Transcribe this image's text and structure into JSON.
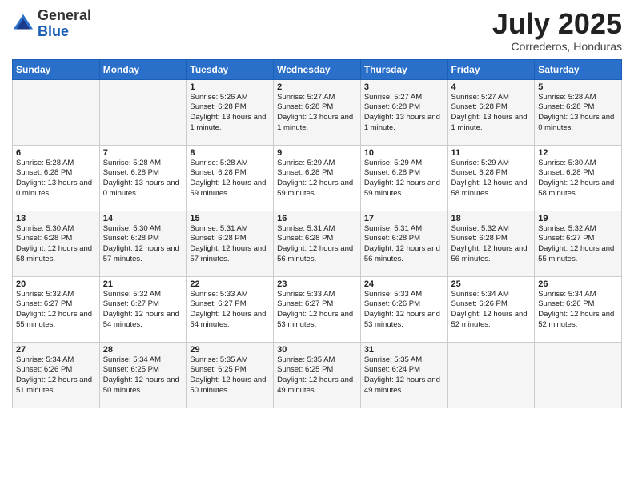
{
  "header": {
    "logo_general": "General",
    "logo_blue": "Blue",
    "month": "July 2025",
    "location": "Correderos, Honduras"
  },
  "weekdays": [
    "Sunday",
    "Monday",
    "Tuesday",
    "Wednesday",
    "Thursday",
    "Friday",
    "Saturday"
  ],
  "weeks": [
    [
      {
        "day": "",
        "info": ""
      },
      {
        "day": "",
        "info": ""
      },
      {
        "day": "1",
        "info": "Sunrise: 5:26 AM\nSunset: 6:28 PM\nDaylight: 13 hours and 1 minute."
      },
      {
        "day": "2",
        "info": "Sunrise: 5:27 AM\nSunset: 6:28 PM\nDaylight: 13 hours and 1 minute."
      },
      {
        "day": "3",
        "info": "Sunrise: 5:27 AM\nSunset: 6:28 PM\nDaylight: 13 hours and 1 minute."
      },
      {
        "day": "4",
        "info": "Sunrise: 5:27 AM\nSunset: 6:28 PM\nDaylight: 13 hours and 1 minute."
      },
      {
        "day": "5",
        "info": "Sunrise: 5:28 AM\nSunset: 6:28 PM\nDaylight: 13 hours and 0 minutes."
      }
    ],
    [
      {
        "day": "6",
        "info": "Sunrise: 5:28 AM\nSunset: 6:28 PM\nDaylight: 13 hours and 0 minutes."
      },
      {
        "day": "7",
        "info": "Sunrise: 5:28 AM\nSunset: 6:28 PM\nDaylight: 13 hours and 0 minutes."
      },
      {
        "day": "8",
        "info": "Sunrise: 5:28 AM\nSunset: 6:28 PM\nDaylight: 12 hours and 59 minutes."
      },
      {
        "day": "9",
        "info": "Sunrise: 5:29 AM\nSunset: 6:28 PM\nDaylight: 12 hours and 59 minutes."
      },
      {
        "day": "10",
        "info": "Sunrise: 5:29 AM\nSunset: 6:28 PM\nDaylight: 12 hours and 59 minutes."
      },
      {
        "day": "11",
        "info": "Sunrise: 5:29 AM\nSunset: 6:28 PM\nDaylight: 12 hours and 58 minutes."
      },
      {
        "day": "12",
        "info": "Sunrise: 5:30 AM\nSunset: 6:28 PM\nDaylight: 12 hours and 58 minutes."
      }
    ],
    [
      {
        "day": "13",
        "info": "Sunrise: 5:30 AM\nSunset: 6:28 PM\nDaylight: 12 hours and 58 minutes."
      },
      {
        "day": "14",
        "info": "Sunrise: 5:30 AM\nSunset: 6:28 PM\nDaylight: 12 hours and 57 minutes."
      },
      {
        "day": "15",
        "info": "Sunrise: 5:31 AM\nSunset: 6:28 PM\nDaylight: 12 hours and 57 minutes."
      },
      {
        "day": "16",
        "info": "Sunrise: 5:31 AM\nSunset: 6:28 PM\nDaylight: 12 hours and 56 minutes."
      },
      {
        "day": "17",
        "info": "Sunrise: 5:31 AM\nSunset: 6:28 PM\nDaylight: 12 hours and 56 minutes."
      },
      {
        "day": "18",
        "info": "Sunrise: 5:32 AM\nSunset: 6:28 PM\nDaylight: 12 hours and 56 minutes."
      },
      {
        "day": "19",
        "info": "Sunrise: 5:32 AM\nSunset: 6:27 PM\nDaylight: 12 hours and 55 minutes."
      }
    ],
    [
      {
        "day": "20",
        "info": "Sunrise: 5:32 AM\nSunset: 6:27 PM\nDaylight: 12 hours and 55 minutes."
      },
      {
        "day": "21",
        "info": "Sunrise: 5:32 AM\nSunset: 6:27 PM\nDaylight: 12 hours and 54 minutes."
      },
      {
        "day": "22",
        "info": "Sunrise: 5:33 AM\nSunset: 6:27 PM\nDaylight: 12 hours and 54 minutes."
      },
      {
        "day": "23",
        "info": "Sunrise: 5:33 AM\nSunset: 6:27 PM\nDaylight: 12 hours and 53 minutes."
      },
      {
        "day": "24",
        "info": "Sunrise: 5:33 AM\nSunset: 6:26 PM\nDaylight: 12 hours and 53 minutes."
      },
      {
        "day": "25",
        "info": "Sunrise: 5:34 AM\nSunset: 6:26 PM\nDaylight: 12 hours and 52 minutes."
      },
      {
        "day": "26",
        "info": "Sunrise: 5:34 AM\nSunset: 6:26 PM\nDaylight: 12 hours and 52 minutes."
      }
    ],
    [
      {
        "day": "27",
        "info": "Sunrise: 5:34 AM\nSunset: 6:26 PM\nDaylight: 12 hours and 51 minutes."
      },
      {
        "day": "28",
        "info": "Sunrise: 5:34 AM\nSunset: 6:25 PM\nDaylight: 12 hours and 50 minutes."
      },
      {
        "day": "29",
        "info": "Sunrise: 5:35 AM\nSunset: 6:25 PM\nDaylight: 12 hours and 50 minutes."
      },
      {
        "day": "30",
        "info": "Sunrise: 5:35 AM\nSunset: 6:25 PM\nDaylight: 12 hours and 49 minutes."
      },
      {
        "day": "31",
        "info": "Sunrise: 5:35 AM\nSunset: 6:24 PM\nDaylight: 12 hours and 49 minutes."
      },
      {
        "day": "",
        "info": ""
      },
      {
        "day": "",
        "info": ""
      }
    ]
  ]
}
